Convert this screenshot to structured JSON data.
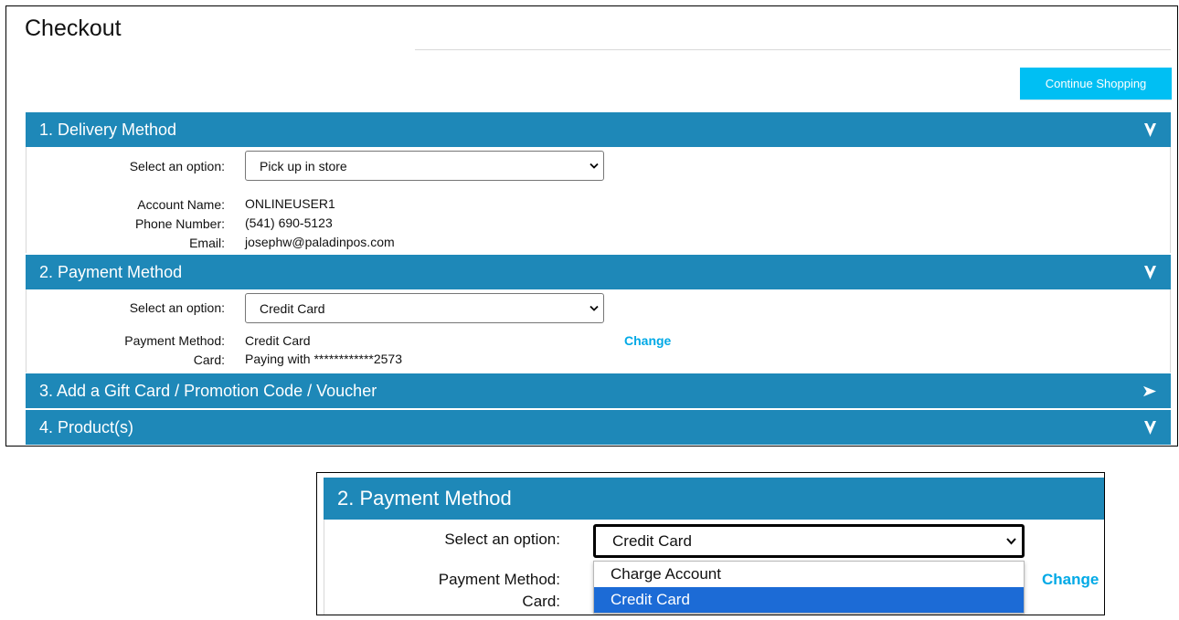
{
  "page": {
    "title": "Checkout"
  },
  "toolbar": {
    "continue_label": "Continue Shopping"
  },
  "colors": {
    "header_bg": "#1e88b8",
    "accent": "#00bff3",
    "link": "#00a9e6",
    "option_highlight": "#1c6bd6"
  },
  "sections": [
    {
      "title": "1. Delivery Method",
      "state_icon": "chevron-down-icon",
      "select_label": "Select an option:",
      "select_value": "Pick up in store",
      "fields": [
        {
          "label": "Account Name:",
          "value": "ONLINEUSER1"
        },
        {
          "label": "Phone Number:",
          "value": "(541) 690-5123"
        },
        {
          "label": "Email:",
          "value": "josephw@paladinpos.com"
        }
      ]
    },
    {
      "title": "2. Payment Method",
      "state_icon": "chevron-down-icon",
      "select_label": "Select an option:",
      "select_value": "Credit Card",
      "change_label": "Change",
      "fields": [
        {
          "label": "Payment Method:",
          "value": "Credit Card"
        },
        {
          "label": "Card:",
          "value": "Paying with ************2573"
        }
      ]
    },
    {
      "title": "3. Add a Gift Card / Promotion Code / Voucher",
      "state_icon": "chevron-right-icon"
    },
    {
      "title": "4. Product(s)",
      "state_icon": "chevron-down-icon"
    }
  ],
  "zoom": {
    "title": "2. Payment Method",
    "select_label": "Select an option:",
    "select_value": "Credit Card",
    "payment_method_label": "Payment Method:",
    "card_label": "Card:",
    "change_label": "Change",
    "options": [
      "Charge Account",
      "Credit Card"
    ],
    "highlighted_option": "Credit Card"
  }
}
